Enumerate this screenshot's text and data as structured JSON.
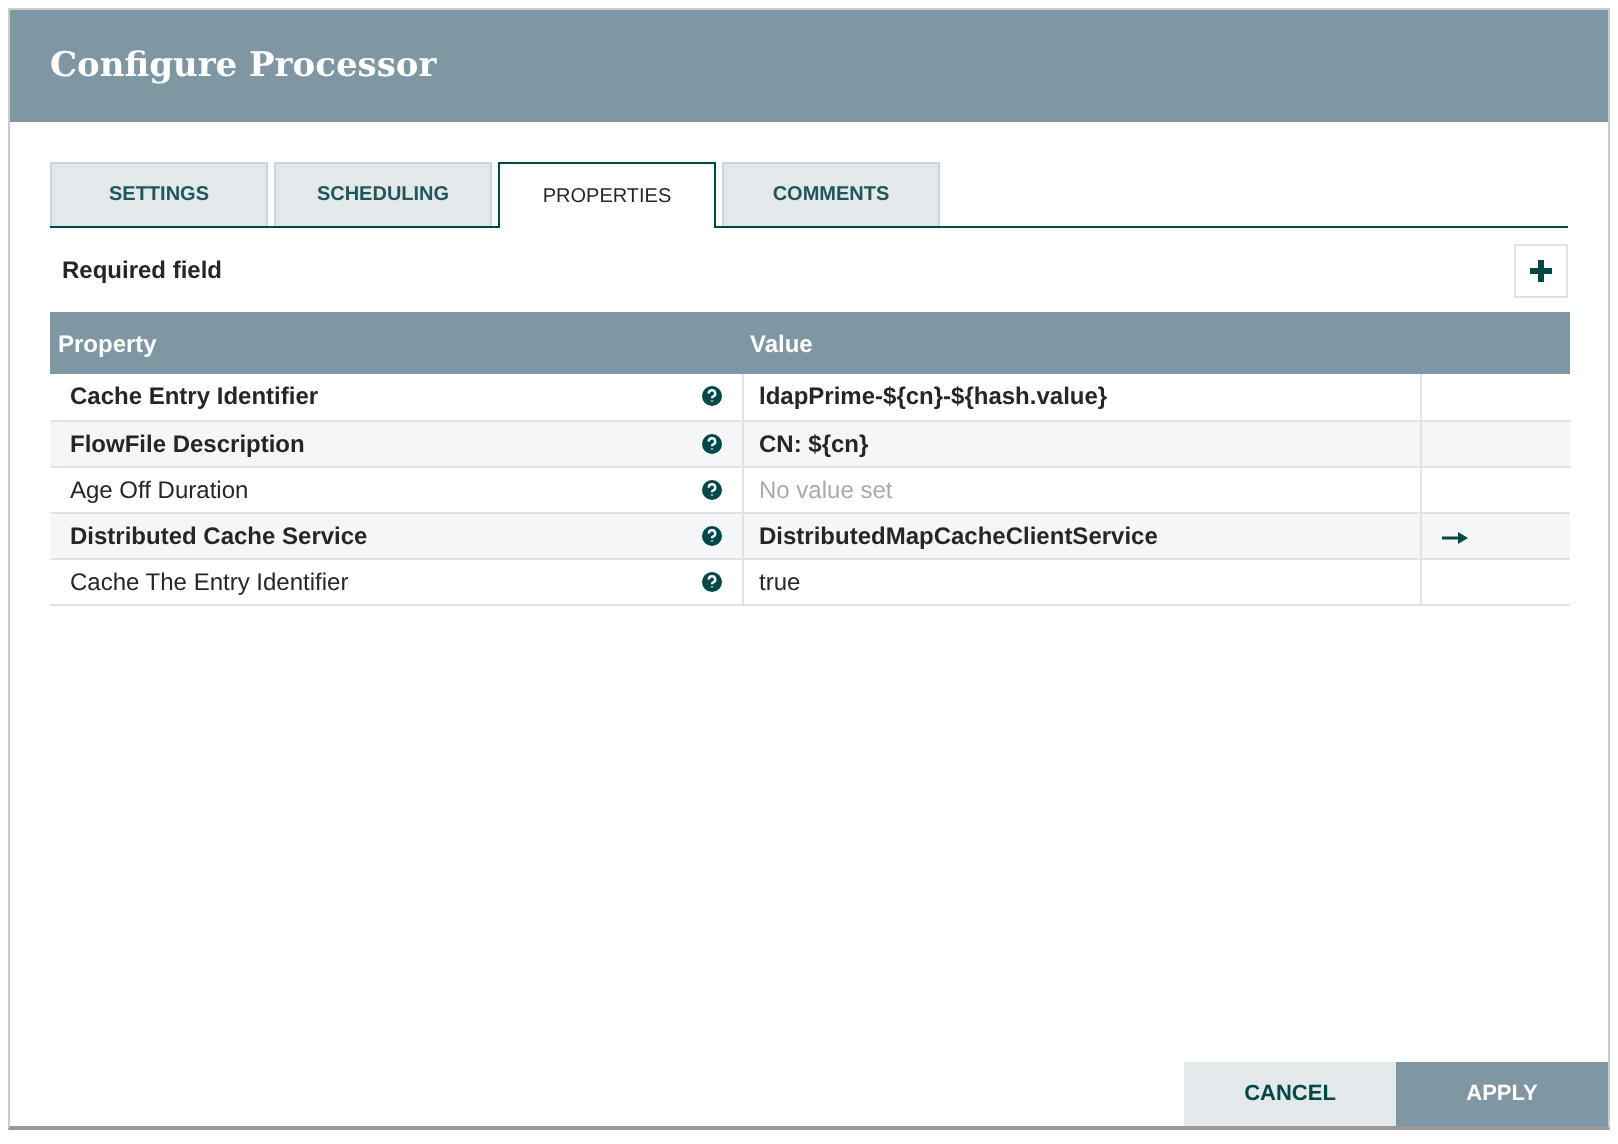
{
  "window": {
    "title": "Configure Processor"
  },
  "tabs": [
    {
      "label": "SETTINGS",
      "selected": false
    },
    {
      "label": "SCHEDULING",
      "selected": false
    },
    {
      "label": "PROPERTIES",
      "selected": true
    },
    {
      "label": "COMMENTS",
      "selected": false
    }
  ],
  "legend": "Required field",
  "table": {
    "columns": [
      "Property",
      "Value"
    ],
    "rows": [
      {
        "property": "Cache Entry Identifier",
        "required": true,
        "value": "ldapPrime-${cn}-${hash.value}",
        "value_set": true,
        "link": false
      },
      {
        "property": "FlowFile Description",
        "required": true,
        "value": "CN: ${cn}",
        "value_set": true,
        "link": false
      },
      {
        "property": "Age Off Duration",
        "required": false,
        "value": "No value set",
        "value_set": false,
        "link": false
      },
      {
        "property": "Distributed Cache Service",
        "required": true,
        "value": "DistributedMapCacheClientService",
        "value_set": true,
        "link": true
      },
      {
        "property": "Cache The Entry Identifier",
        "required": false,
        "value": "true",
        "value_set": true,
        "link": false
      }
    ]
  },
  "buttons": [
    {
      "label": "CANCEL",
      "kind": "secondary"
    },
    {
      "label": "APPLY",
      "kind": "primary"
    }
  ]
}
